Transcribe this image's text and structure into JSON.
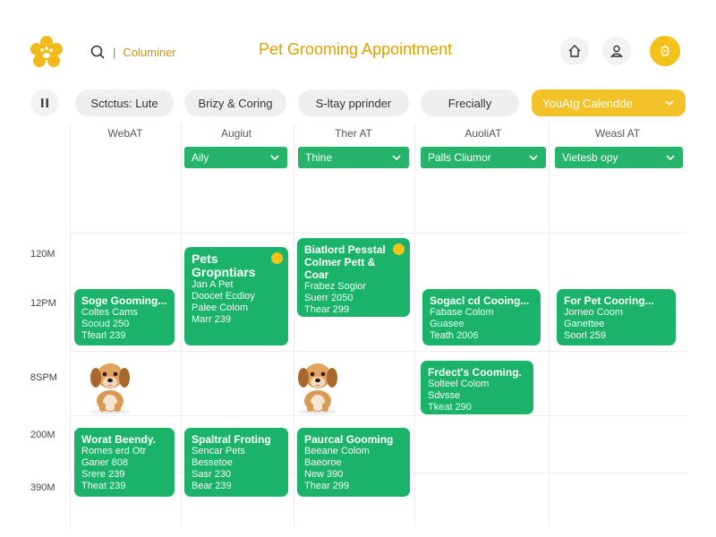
{
  "header": {
    "title": "Pet Grooming Appointment",
    "search_text": "Columiner",
    "search_sep": "|"
  },
  "filters": [
    {
      "label": "Sctctus: Lute"
    },
    {
      "label": "Brizy & Coring"
    },
    {
      "label": "S-ltay pprinder"
    },
    {
      "label": "Frecially"
    },
    {
      "label": "YouAtg Calendde"
    }
  ],
  "columns": [
    {
      "header": "WebAT",
      "dropdown": ""
    },
    {
      "header": "Augiut",
      "dropdown": "Aily"
    },
    {
      "header": "Ther AT",
      "dropdown": "Thine"
    },
    {
      "header": "AuoliAT",
      "dropdown": "Palls Cliumor"
    },
    {
      "header": "Weasl AT",
      "dropdown": "Vietesb opy"
    }
  ],
  "times": [
    "120M",
    "12PM",
    "8SPM",
    "200M",
    "390M"
  ],
  "cards": [
    {
      "title": "Pets Gropntiars",
      "lines": [
        "Jan A Pet",
        "Doocet Ecdioy",
        "Palee Colom",
        "Marr 239"
      ]
    },
    {
      "title": "Biatlord Pesstal Colmer Pett & Coar",
      "lines": [
        "Frabez Sogior",
        "Suerr 2050",
        "Thear 299"
      ]
    },
    {
      "title": "Soge Gooming...",
      "lines": [
        "Coltes Cams",
        "Sooud 250",
        "Tfearl 239"
      ]
    },
    {
      "title": "Sogacl cd Cooing...",
      "lines": [
        "Fabase Colom",
        "Guasee",
        "Teath 2006"
      ]
    },
    {
      "title": "For Pet Cooring...",
      "lines": [
        "Jorneo Coom",
        "Ganettee",
        "Soorl 259"
      ]
    },
    {
      "title": "Frdect's Cooming.",
      "lines": [
        "Solteel Colom",
        "Sdvsse",
        "Tkeat 290"
      ]
    },
    {
      "title": "Worat Beendy.",
      "lines": [
        "Romes erd Otr",
        "Ganer 808",
        "Srere 239",
        "Theat 239"
      ]
    },
    {
      "title": "Spaltral Froting",
      "lines": [
        "Sencar Pets",
        "Bessetoe",
        "Sasr 230",
        "Bear 239"
      ]
    },
    {
      "title": "Paurcal Gooming",
      "lines": [
        "Beeane Colom",
        "Baeoroe",
        "New 390",
        "Thear 299"
      ]
    }
  ],
  "colors": {
    "accent": "#f2c21a",
    "title": "#d9a300",
    "card_green": "#1bb36a",
    "dropdown_green": "#26b36a"
  }
}
